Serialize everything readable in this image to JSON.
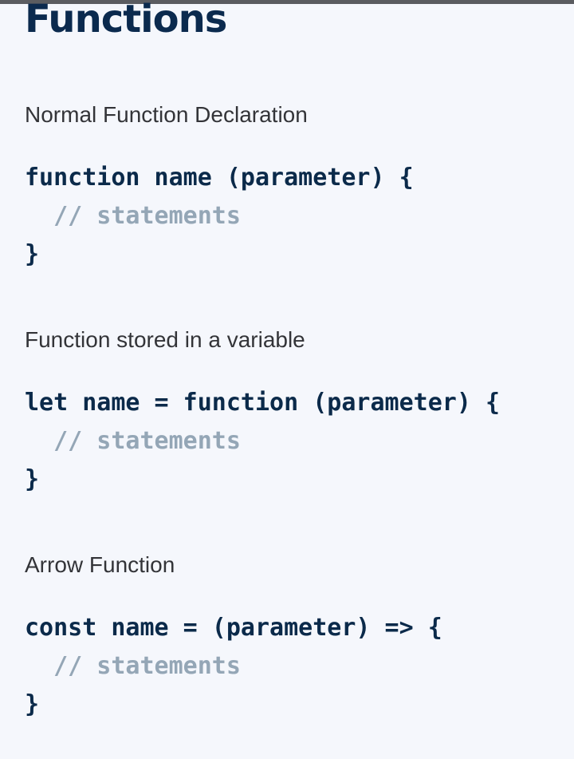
{
  "title": "Functions",
  "sections": [
    {
      "heading": "Normal Function Declaration",
      "line1": "function name (parameter) {",
      "comment": "  // statements",
      "close": "}"
    },
    {
      "heading": "Function stored in a variable",
      "line1": "let name = function (parameter) {",
      "comment": "  // statements",
      "close": "}"
    },
    {
      "heading": "Arrow Function",
      "line1": "const name = (parameter) => {",
      "comment": "  // statements",
      "close": "}"
    }
  ]
}
